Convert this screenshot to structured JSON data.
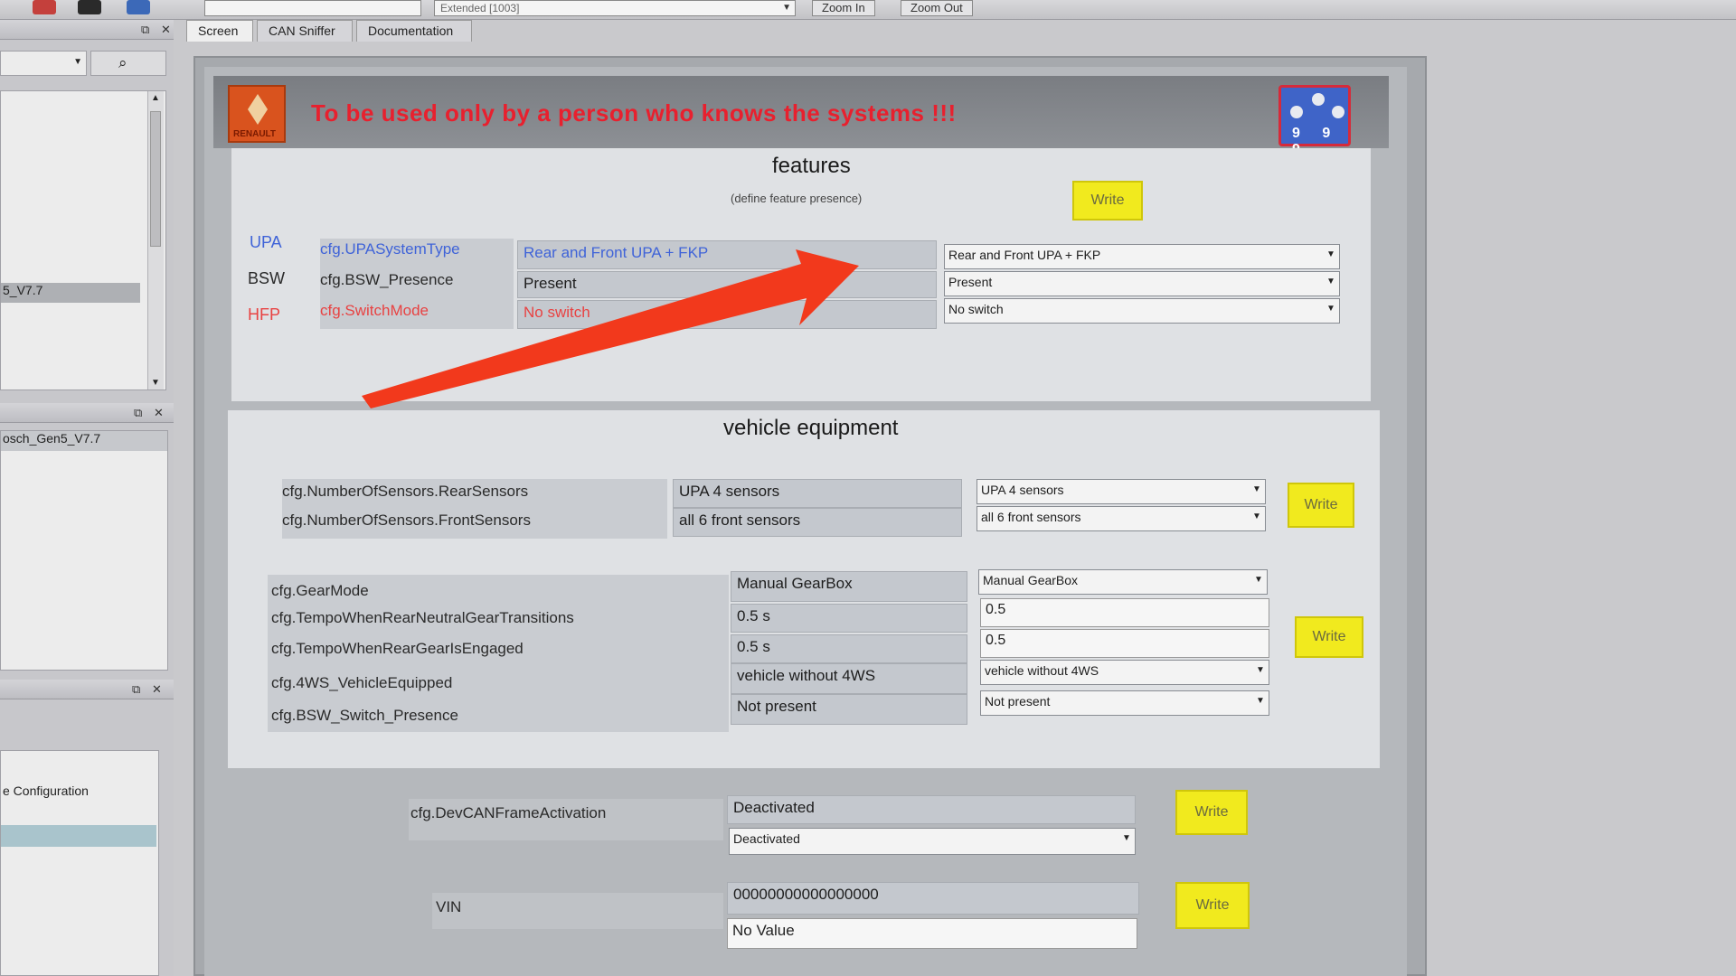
{
  "toolbar": {
    "combo_left_value": "",
    "combo_right_value": "Extended [1003]",
    "zoom_in_label": "Zoom In",
    "zoom_out_label": "Zoom Out"
  },
  "left_panels": {
    "panel1_item_selected": "5_V7.7",
    "panel2_item": "osch_Gen5_V7.7",
    "panel3_item": "e Configuration"
  },
  "tabs": [
    {
      "label": "Screen",
      "active": true
    },
    {
      "label": "CAN Sniffer",
      "active": false
    },
    {
      "label": "Documentation",
      "active": false
    }
  ],
  "header": {
    "warning": "To be used only by a person who knows the systems !!!",
    "logo_text": "RENAULT",
    "tool_glyphs": "9 9 9"
  },
  "features": {
    "title": "features",
    "subtitle": "(define feature presence)",
    "write_label": "Write",
    "rows": [
      {
        "tag": "UPA",
        "param": "cfg.UPASystemType",
        "value": "Rear and Front UPA + FKP",
        "combo": "Rear and Front UPA + FKP"
      },
      {
        "tag": "BSW",
        "param": "cfg.BSW_Presence",
        "value": "Present",
        "combo": "Present"
      },
      {
        "tag": "HFP",
        "param": "cfg.SwitchMode",
        "value": "No switch",
        "combo": "No switch"
      }
    ]
  },
  "vehicle_equipment": {
    "title": "vehicle equipment",
    "sensors": [
      {
        "param": "cfg.NumberOfSensors.RearSensors",
        "value": "UPA 4 sensors",
        "combo": "UPA 4 sensors"
      },
      {
        "param": "cfg.NumberOfSensors.FrontSensors",
        "value": "all 6 front sensors",
        "combo": "all 6 front sensors"
      }
    ],
    "sensors_write_label": "Write",
    "gear": [
      {
        "param": "cfg.GearMode",
        "value": "Manual GearBox",
        "combo": "Manual GearBox",
        "kind": "combo"
      },
      {
        "param": "cfg.TempoWhenRearNeutralGearTransitions",
        "value": "0.5 s",
        "combo": "0.5",
        "kind": "input"
      },
      {
        "param": "cfg.TempoWhenRearGearIsEngaged",
        "value": "0.5 s",
        "combo": "0.5",
        "kind": "input"
      },
      {
        "param": "cfg.4WS_VehicleEquipped",
        "value": "vehicle without 4WS",
        "combo": "vehicle without 4WS",
        "kind": "combo"
      },
      {
        "param": "cfg.BSW_Switch_Presence",
        "value": "Not present",
        "combo": "Not present",
        "kind": "combo"
      }
    ],
    "gear_write_label": "Write"
  },
  "dev_can": {
    "param": "cfg.DevCANFrameActivation",
    "value": "Deactivated",
    "combo": "Deactivated",
    "write_label": "Write"
  },
  "vin": {
    "label": "VIN",
    "value": "00000000000000000",
    "input_value": "No Value",
    "write_label": "Write"
  },
  "colors": {
    "accent_write": "#f1ea1e",
    "warning_red": "#e8202e",
    "upa_blue": "#3f63d8",
    "hfp_red": "#e84242",
    "annotation_arrow": "#f2391c"
  },
  "icons": [
    "chevron-down-icon",
    "restore-icon",
    "close-icon",
    "search-icon",
    "renault-logo",
    "tool-icon",
    "annotation-arrow"
  ]
}
